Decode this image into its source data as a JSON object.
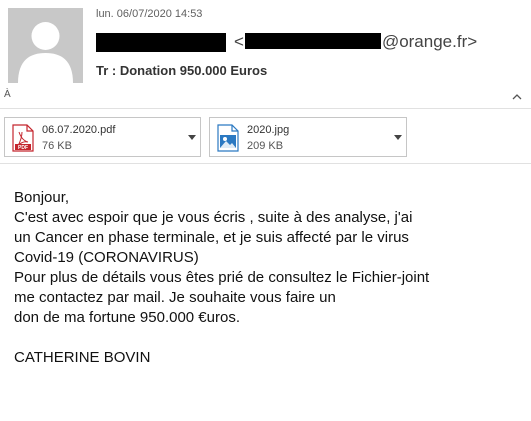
{
  "header": {
    "date": "lun. 06/07/2020 14:53",
    "from_email_open": "<",
    "from_email_domain": "@orange.fr>",
    "subject": "Tr : Donation 950.000 Euros",
    "to_label": "À"
  },
  "attachments": [
    {
      "name": "06.07.2020.pdf",
      "size": "76 KB",
      "icon": "pdf-file-icon",
      "badge": "PDF"
    },
    {
      "name": "2020.jpg",
      "size": "209 KB",
      "icon": "image-file-icon"
    }
  ],
  "body": {
    "lines": [
      "Bonjour,",
      "C'est avec espoir que je vous écris , suite à des analyse, j'ai",
      "un Cancer en phase terminale, et je suis affecté par le virus",
      "Covid-19 (CORONAVIRUS)",
      "Pour plus de détails vous êtes prié de consultez le Fichier-joint",
      "me contactez par mail. Je souhaite vous faire un",
      "don de ma fortune 950.000 €uros.",
      "",
      "CATHERINE BOVIN"
    ]
  },
  "colors": {
    "pdf_red": "#c4262e",
    "image_blue": "#2b79c2",
    "divider": "#e1e1e1",
    "avatar_bg": "#c8c8c8"
  }
}
